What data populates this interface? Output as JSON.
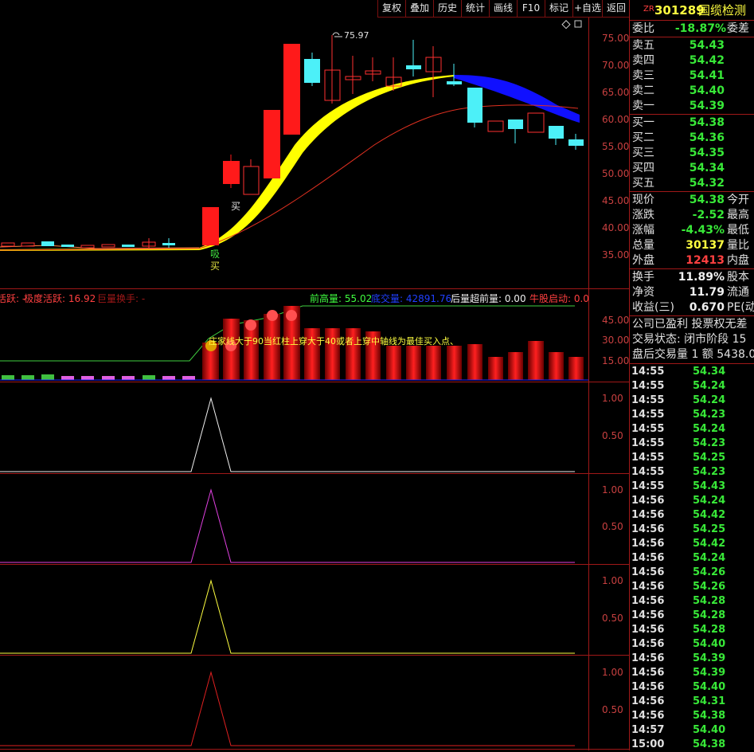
{
  "toolbar": {
    "buttons": [
      "复权",
      "叠加",
      "历史",
      "统计",
      "画线",
      "F10",
      "标记",
      "+自选",
      "返回"
    ]
  },
  "main_chart": {
    "y_ticks": [
      "75.00",
      "70.00",
      "65.00",
      "60.00",
      "55.00",
      "50.00",
      "45.00",
      "40.00",
      "35.00"
    ],
    "high_label": "75.97",
    "signal_buy": "买",
    "signal_absorb_1": "吸",
    "signal_absorb_2": "买"
  },
  "volume_panel": {
    "legend_left": "活跃: -",
    "legend_extreme": "极度活跃: 16.92",
    "legend_huge": "巨量换手: -",
    "legend_prev_high": "前高量: 55.02",
    "legend_bottom": "底交量: 42891.76",
    "legend_after": "后量超前量: 0.00",
    "legend_bull": "牛股启动: 0.00",
    "annotation": "庄家线大于90当红柱上穿大于40或者上穿中轴线为最佳买入点、",
    "y_ticks": [
      "45.00",
      "30.00",
      "15.00"
    ]
  },
  "sub_panels": [
    {
      "y_ticks": [
        "1.00",
        "0.50"
      ]
    },
    {
      "y_ticks": [
        "1.00",
        "0.50"
      ]
    },
    {
      "y_ticks": [
        "1.00",
        "0.50"
      ]
    },
    {
      "y_ticks": [
        "1.00",
        "0.50"
      ]
    }
  ],
  "colors": {
    "bull": "#ff1a1a",
    "bear": "#4cf0f8",
    "yellow_band": "#ffff00",
    "blue_band": "#1010ff",
    "ma_line": "#e03020",
    "axis": "#a01818"
  },
  "stock": {
    "prefix": "ZR",
    "code": "301289",
    "name": "国缆检测"
  },
  "order_book": {
    "weibi_label": "委比",
    "weibi_value": "-18.87%",
    "weicha_label": "委差",
    "asks": [
      {
        "label": "卖五",
        "price": "54.43"
      },
      {
        "label": "卖四",
        "price": "54.42"
      },
      {
        "label": "卖三",
        "price": "54.41"
      },
      {
        "label": "卖二",
        "price": "54.40"
      },
      {
        "label": "卖一",
        "price": "54.39"
      }
    ],
    "bids": [
      {
        "label": "买一",
        "price": "54.38"
      },
      {
        "label": "买二",
        "price": "54.36"
      },
      {
        "label": "买三",
        "price": "54.35"
      },
      {
        "label": "买四",
        "price": "54.34"
      },
      {
        "label": "买五",
        "price": "54.32"
      }
    ]
  },
  "quote": [
    {
      "label": "现价",
      "value": "54.38",
      "tail": "今开",
      "color": "green"
    },
    {
      "label": "涨跌",
      "value": "-2.52",
      "tail": "最高",
      "color": "green"
    },
    {
      "label": "涨幅",
      "value": "-4.43%",
      "tail": "最低",
      "color": "green"
    },
    {
      "label": "总量",
      "value": "30137",
      "tail": "量比",
      "color": "yellow"
    },
    {
      "label": "外盘",
      "value": "12413",
      "tail": "内盘",
      "color": "red"
    }
  ],
  "quote2": [
    {
      "label": "换手",
      "value": "11.89%",
      "tail": "股本",
      "color": "white"
    },
    {
      "label": "净资",
      "value": "11.79",
      "tail": "流通",
      "color": "white"
    },
    {
      "label": "收益(三)",
      "value": "0.670",
      "tail": "PE(动",
      "color": "white"
    }
  ],
  "info_lines": [
    "公司已盈利 投票权无差",
    "交易状态: 闭市阶段 15",
    "盘后交易量 1 额 5438.0"
  ],
  "ticks": [
    {
      "time": "14:55",
      "price": "54.34"
    },
    {
      "time": "14:55",
      "price": "54.24"
    },
    {
      "time": "14:55",
      "price": "54.24"
    },
    {
      "time": "14:55",
      "price": "54.23"
    },
    {
      "time": "14:55",
      "price": "54.24"
    },
    {
      "time": "14:55",
      "price": "54.23"
    },
    {
      "time": "14:55",
      "price": "54.25"
    },
    {
      "time": "14:55",
      "price": "54.23"
    },
    {
      "time": "14:55",
      "price": "54.43"
    },
    {
      "time": "14:56",
      "price": "54.24"
    },
    {
      "time": "14:56",
      "price": "54.42"
    },
    {
      "time": "14:56",
      "price": "54.25"
    },
    {
      "time": "14:56",
      "price": "54.42"
    },
    {
      "time": "14:56",
      "price": "54.24"
    },
    {
      "time": "14:56",
      "price": "54.26"
    },
    {
      "time": "14:56",
      "price": "54.26"
    },
    {
      "time": "14:56",
      "price": "54.28"
    },
    {
      "time": "14:56",
      "price": "54.28"
    },
    {
      "time": "14:56",
      "price": "54.28"
    },
    {
      "time": "14:56",
      "price": "54.40"
    },
    {
      "time": "14:56",
      "price": "54.39"
    },
    {
      "time": "14:56",
      "price": "54.39"
    },
    {
      "time": "14:56",
      "price": "54.40"
    },
    {
      "time": "14:56",
      "price": "54.31"
    },
    {
      "time": "14:56",
      "price": "54.38"
    },
    {
      "time": "14:57",
      "price": "54.40"
    },
    {
      "time": "15:00",
      "price": "54.38"
    }
  ]
}
